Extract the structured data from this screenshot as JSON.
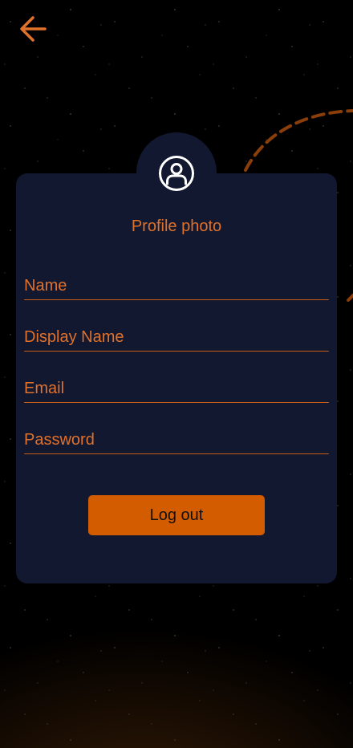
{
  "header": {
    "back_icon": "arrow-left-icon"
  },
  "profile": {
    "avatar_icon": "user-circle-icon",
    "photo_label": "Profile photo"
  },
  "form": {
    "fields": [
      {
        "label": "Name"
      },
      {
        "label": "Display Name"
      },
      {
        "label": "Email"
      },
      {
        "label": "Password"
      }
    ]
  },
  "actions": {
    "logout_label": "Log out"
  },
  "colors": {
    "accent": "#E0712A",
    "button": "#D45C00",
    "card": "#121830",
    "background": "#000000"
  }
}
